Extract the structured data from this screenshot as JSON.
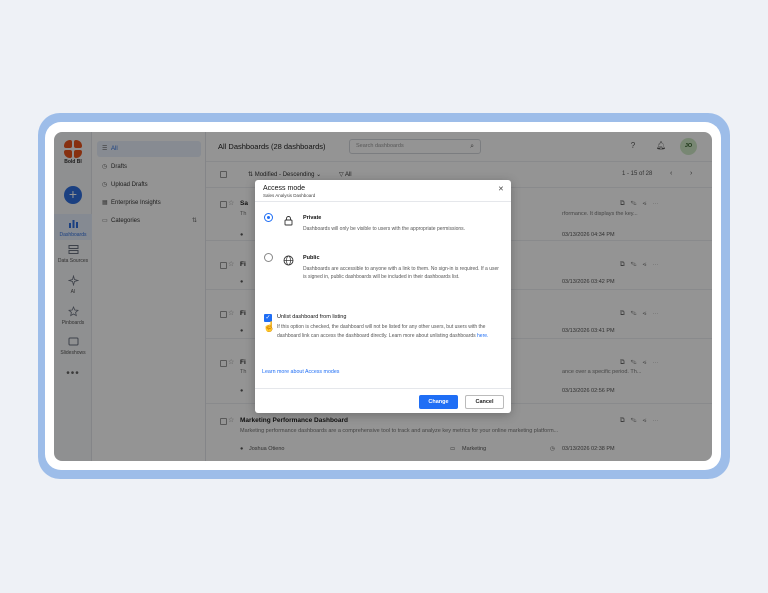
{
  "app": {
    "logo_name": "Bold BI"
  },
  "rail": {
    "items": [
      {
        "label": "Dashboards",
        "icon": "bar-chart-icon"
      },
      {
        "label": "Data Sources",
        "icon": "database-icon"
      },
      {
        "label": "AI",
        "icon": "ai-sparkle-icon"
      },
      {
        "label": "Pinboards",
        "icon": "pin-icon"
      },
      {
        "label": "Slideshows",
        "icon": "slideshow-icon"
      }
    ],
    "more": "•••"
  },
  "nav": {
    "items": [
      {
        "label": "All",
        "icon": "list-icon"
      },
      {
        "label": "Drafts",
        "icon": "clock-icon"
      },
      {
        "label": "Upload Drafts",
        "icon": "upload-icon"
      },
      {
        "label": "Enterprise Insights",
        "icon": "insights-icon"
      },
      {
        "label": "Categories",
        "icon": "folder-icon"
      }
    ]
  },
  "header": {
    "title": "All Dashboards (28 dashboards)",
    "search_placeholder": "Search dashboards",
    "avatar_initials": "JO"
  },
  "toolbar": {
    "sort_label": "Modified - Descending",
    "filter_label": "All",
    "pagination": "1 - 15 of 28"
  },
  "rows": [
    {
      "name": "Sa",
      "desc_start": "Th",
      "desc_end": "rformance. It displays the key...",
      "owner": "",
      "date": "03/13/2026 04:34 PM"
    },
    {
      "name": "Fi",
      "desc_start": "",
      "desc_end": "",
      "owner": "",
      "date": "03/13/2026 03:42 PM"
    },
    {
      "name": "Fi",
      "desc_start": "",
      "desc_end": "",
      "owner": "",
      "date": "03/13/2026 03:41 PM"
    },
    {
      "name": "Fi",
      "desc_start": "Th",
      "desc_end": "ance over a specific period. Th...",
      "owner": "",
      "date": "03/13/2026 02:56 PM"
    },
    {
      "name": "Marketing Performance Dashboard",
      "desc_start": "Marketing performance dashboards are a comprehensive tool to track and analyze key metrics for your online marketing platform...",
      "desc_end": "",
      "owner": "Joshua Otieno",
      "category": "Marketing",
      "date": "03/13/2026 02:38 PM"
    }
  ],
  "modal": {
    "title": "Access mode",
    "subtitle": "Sales Analysis Dashboard",
    "options": [
      {
        "title": "Private",
        "desc": "Dashboards will only be visible to users with the appropriate permissions.",
        "selected": true,
        "icon": "lock-icon"
      },
      {
        "title": "Public",
        "desc": "Dashboards are accessible to anyone with a link to them. No sign-in is required. If a user is signed in, public dashboards will be included in their dashboards list.",
        "selected": false,
        "icon": "globe-icon"
      }
    ],
    "unlist_label": "Unlist dashboard from listing",
    "unlist_desc": "If this option is checked, the dashboard will not be listed for any other users, but users with the dashboard link can access the dashboard directly. Learn more about unlisting dashboards",
    "unlist_link": "here.",
    "learn_more": "Learn more about Access modes",
    "change_label": "Change",
    "cancel_label": "Cancel"
  },
  "colors": {
    "accent": "#1f6ef5",
    "brand": "#e8531d",
    "frame": "#9dbde9"
  }
}
